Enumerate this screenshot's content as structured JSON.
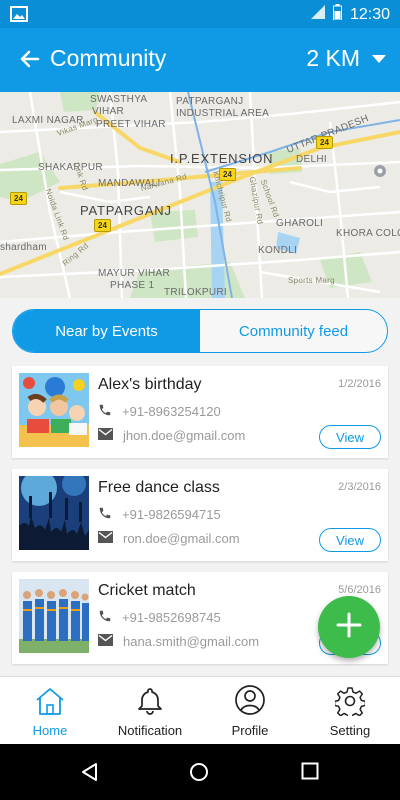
{
  "status_bar": {
    "time": "12:30"
  },
  "header": {
    "title": "Community",
    "distance": "2 KM"
  },
  "map": {
    "labels": {
      "swasthya_vihar": "SWASTHYA",
      "swasthya_vihar2": "VIHAR",
      "patparganj_ind": "PATPARGANJ",
      "patparganj_ind2": "INDUSTRIAL AREA",
      "laxmi_nagar": "LAXMI NAGAR",
      "preet_vihar": "PREET VIHAR",
      "vikas_marg": "Vikas Marg",
      "uttar_pradesh": "UTTAR PRADESH",
      "delhi": "DELHI",
      "ip_extension": "I.P.EXTENSION",
      "shakarpur": "SHAKARPUR",
      "mandawali": "MANDAWALI",
      "narwana_rd": "Narwana Rd",
      "patparganj": "PATPARGANJ",
      "gharoli": "GHAROLI",
      "khora_colony": "KHORA COLONY",
      "shardham": "shardham",
      "kondli": "KONDLI",
      "mayur_vihar": "MAYUR VIHAR",
      "mayur_vihar2": "PHASE 1",
      "trilokpuri": "TRILOKPURI",
      "noida_link": "Noida Link Rd",
      "khichripur_rd": "Khichripur Rd",
      "ghazipur_rd": "Ghazipur Rd",
      "school_rd": "School Rd",
      "link_rd": "Link Rd",
      "ring_rd": "Ring Rd",
      "sports_marg": "Sports Marg"
    },
    "shields": [
      "24",
      "24",
      "24",
      "24"
    ]
  },
  "tabs": {
    "active": "Near by Events",
    "inactive": "Community feed"
  },
  "events": [
    {
      "name": "Alex's birthday",
      "date": "1/2/2016",
      "phone": "+91-8963254120",
      "email": "jhon.doe@gmail.com",
      "action": "View"
    },
    {
      "name": "Free dance class",
      "date": "2/3/2016",
      "phone": "+91-9826594715",
      "email": "ron.doe@gmail.com",
      "action": "View"
    },
    {
      "name": "Cricket match",
      "date": "5/6/2016",
      "phone": "+91-9852698745",
      "email": "hana.smith@gmail.com",
      "action": "View"
    }
  ],
  "bottom_nav": [
    {
      "label": "Home",
      "icon": "home-icon",
      "active": true
    },
    {
      "label": "Notification",
      "icon": "bell-icon",
      "active": false
    },
    {
      "label": "Profile",
      "icon": "profile-icon",
      "active": false
    },
    {
      "label": "Setting",
      "icon": "gear-icon",
      "active": false
    }
  ],
  "colors": {
    "primary": "#109ae6",
    "fab": "#3dbb4b",
    "status_bar": "#0a8fd6"
  }
}
